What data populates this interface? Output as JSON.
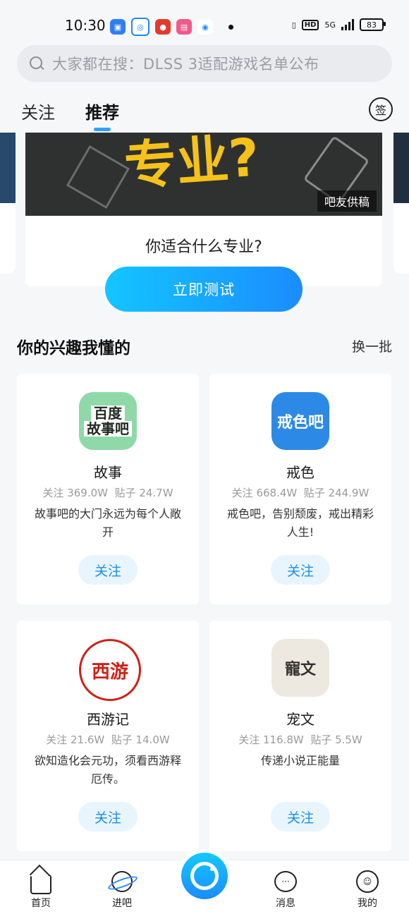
{
  "status": {
    "time": "10:30",
    "battery": "83",
    "network": "5G"
  },
  "search": {
    "placeholder": "大家都在搜：DLSS 3适配游戏名单公布"
  },
  "tabs": {
    "follow": "关注",
    "recommend": "推荐",
    "sign": "签"
  },
  "quiz": {
    "banner_text": "专业?",
    "tag": "吧友供稿",
    "question": "你适合什么专业?",
    "button": "立即测试"
  },
  "interest": {
    "title": "你的兴趣我懂的",
    "refresh": "换一批"
  },
  "forums": [
    {
      "logo": "百度故事吧",
      "logo_lines": [
        "百度",
        "故事吧"
      ],
      "name": "故事",
      "followers": "关注 369.0W",
      "posts": "贴子 24.7W",
      "desc": "故事吧的大门永远为每个人敞开",
      "follow": "关注"
    },
    {
      "logo": "戒色吧",
      "name": "戒色",
      "followers": "关注 668.4W",
      "posts": "贴子 244.9W",
      "desc": "戒色吧，告别颓废，戒出精彩人生!",
      "follow": "关注"
    },
    {
      "logo": "西游",
      "name": "西游记",
      "followers": "关注 21.6W",
      "posts": "贴子 14.0W",
      "desc": "欲知造化会元功，须看西游释厄传。",
      "follow": "关注"
    },
    {
      "logo": "寵文",
      "name": "宠文",
      "followers": "关注 116.8W",
      "posts": "贴子 5.5W",
      "desc": "传递小说正能量",
      "follow": "关注"
    }
  ],
  "nav": {
    "home": "首页",
    "forum": "进吧",
    "messages": "消息",
    "mine": "我的"
  }
}
